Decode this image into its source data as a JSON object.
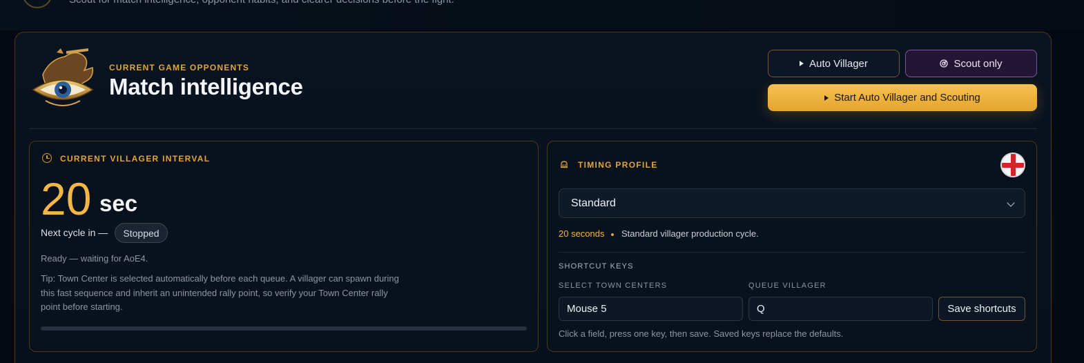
{
  "header": {
    "subtitle": "Scout for match intelligence, opponent habits, and clearer decisions before the fight.",
    "eyebrow": "CURRENT GAME OPPONENTS",
    "title": "Match intelligence"
  },
  "actions": {
    "auto_villager": "Auto Villager",
    "scout_only": "Scout only",
    "start_both": "Start Auto Villager and Scouting"
  },
  "villager_interval": {
    "label": "CURRENT VILLAGER INTERVAL",
    "value": "20",
    "unit": "sec",
    "next_cycle": "Next cycle in —",
    "status": "Stopped",
    "ready": "Ready — waiting for AoE4.",
    "tip": "Tip: Town Center is selected automatically before each queue. A villager can spawn during this fast sequence and inherit an unintended rally point, so verify your Town Center rally point before starting.",
    "progress_fraction": 0
  },
  "timing_profile": {
    "label": "TIMING PROFILE",
    "selected": "Standard",
    "seconds": "20 seconds",
    "description": "Standard villager production cycle."
  },
  "shortcuts": {
    "heading": "SHORTCUT KEYS",
    "town_center_label": "SELECT TOWN CENTERS",
    "town_center_value": "Mouse 5",
    "queue_label": "QUEUE VILLAGER",
    "queue_value": "Q",
    "save": "Save shortcuts",
    "help": "Click a field, press one key, then save. Saved keys replace the defaults."
  },
  "colors": {
    "accent": "#e1a63a",
    "primary_button": "#f2b744",
    "scout_button": "#7b56a3",
    "flag_red": "#d2232a"
  }
}
